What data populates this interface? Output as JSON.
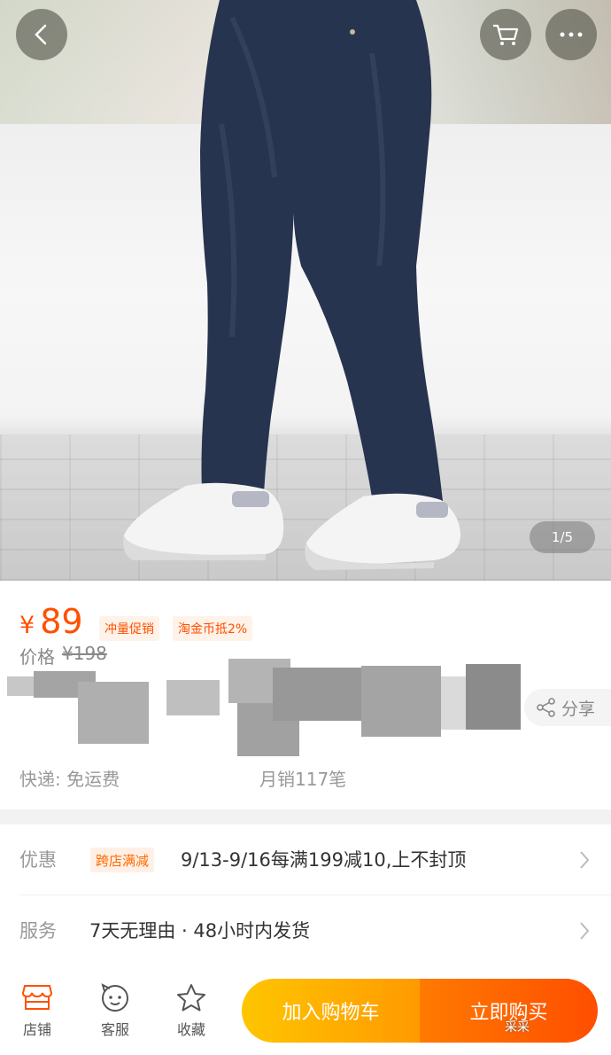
{
  "gallery": {
    "page_indicator": "1/5"
  },
  "header": {
    "back_icon": "chevron-left-icon",
    "cart_icon": "cart-icon",
    "more_icon": "more-icon"
  },
  "product": {
    "price_symbol": "¥",
    "price": "89",
    "tags": [
      "冲量促销",
      "淘金币抵2%"
    ],
    "original_label": "价格",
    "original_price": "¥198",
    "share_label": "分享",
    "shipping": "快递: 免运费",
    "monthly_sales": "月销117笔"
  },
  "promo": {
    "label": "优惠",
    "tag": "跨店满减",
    "text": "9/13-9/16每满199减10,上不封顶"
  },
  "service": {
    "label": "服务",
    "text": "7天无理由 · 48小时内发货"
  },
  "bottom_bar": {
    "shop_label": "店铺",
    "service_label": "客服",
    "favorite_label": "收藏",
    "add_to_cart_label": "加入购物车",
    "buy_now_label": "立即购买"
  },
  "watermark": "采采",
  "colors": {
    "accent": "#ff5000",
    "cart_button": "#ffb300",
    "buy_button": "#ff5a00"
  }
}
